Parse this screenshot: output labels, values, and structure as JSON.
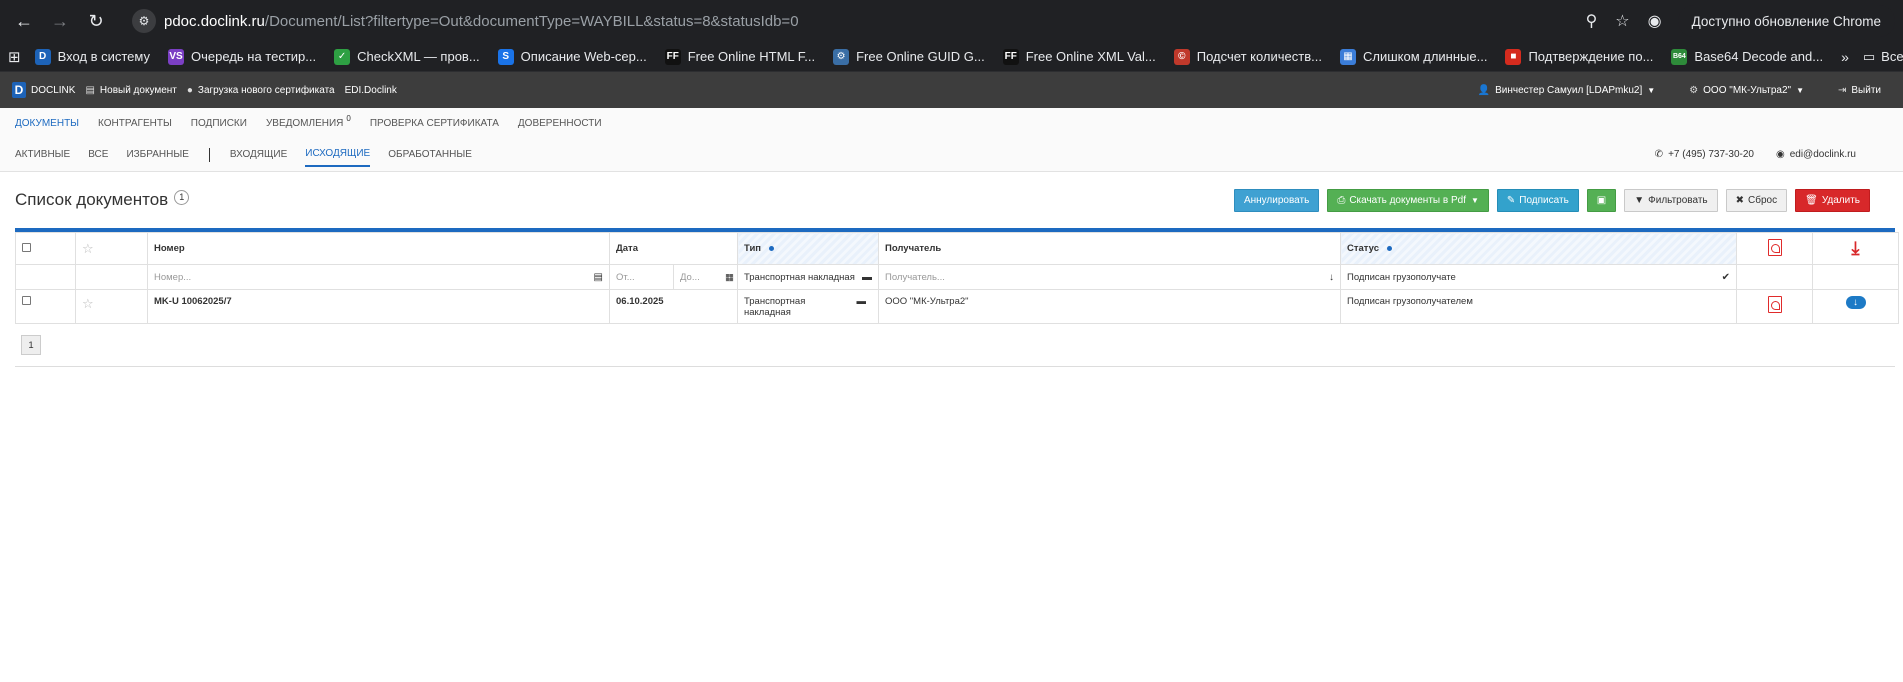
{
  "browser": {
    "url_host": "pdoc.doclink.ru",
    "url_path": "/Document/List?filtertype=Out&documentType=WAYBILL&status=8&statusIdb=0",
    "update_label": "Доступно обновление Chrome"
  },
  "bookmarks": [
    {
      "label": "Вход в систему",
      "icon": "D",
      "color": "#1d63b8"
    },
    {
      "label": "Очередь на тестир...",
      "icon": "VS",
      "color": "#7b3fc4"
    },
    {
      "label": "CheckXML — пров...",
      "icon": "✓",
      "color": "#2ea043"
    },
    {
      "label": "Описание Web-сер...",
      "icon": "S",
      "color": "#1a73e8"
    },
    {
      "label": "Free Online HTML F...",
      "icon": "FF",
      "color": "#111111"
    },
    {
      "label": "Free Online GUID G...",
      "icon": "⚙",
      "color": "#3a6ea5"
    },
    {
      "label": "Free Online XML Val...",
      "icon": "FF",
      "color": "#111111"
    },
    {
      "label": "Подсчет количеств...",
      "icon": "©",
      "color": "#c0392b"
    },
    {
      "label": "Слишком длинные...",
      "icon": "▦",
      "color": "#3b7dd8"
    },
    {
      "label": "Подтверждение по...",
      "icon": "■",
      "color": "#d52b1e"
    },
    {
      "label": "Base64 Decode and...",
      "icon": "B64",
      "color": "#2e8b3a"
    }
  ],
  "bookmarks_folder": "Все закладки",
  "app": {
    "logo": "DOCLINK",
    "new_doc": "Новый документ",
    "upload_cert": "Загрузка нового сертификата",
    "edi": "EDI.Doclink",
    "user": "Винчестер Самуил [LDAPmku2]",
    "org": "ООО \"МК-Ультра2\"",
    "logout": "Выйти"
  },
  "nav_main": [
    {
      "label": "Документы",
      "active": true
    },
    {
      "label": "Контрагенты",
      "active": false
    },
    {
      "label": "Подписки",
      "active": false
    },
    {
      "label": "Уведомления",
      "active": false,
      "badge": "0"
    },
    {
      "label": "Проверка сертификата",
      "active": false
    },
    {
      "label": "Доверенности",
      "active": false
    }
  ],
  "nav_sub": [
    {
      "label": "Активные",
      "active": false
    },
    {
      "label": "Все",
      "active": false
    },
    {
      "label": "Избранные",
      "active": false
    },
    {
      "label": "Входящие",
      "active": false
    },
    {
      "label": "Исходящие",
      "active": true
    },
    {
      "label": "Обработанные",
      "active": false
    }
  ],
  "contact": {
    "phone": "+7 (495) 737-30-20",
    "email": "edi@doclink.ru"
  },
  "page": {
    "title": "Список документов",
    "count": "1"
  },
  "actions": {
    "annul": "Аннулировать",
    "download_pdf": "Скачать документы в Pdf",
    "sign": "Подписать",
    "filter": "Фильтровать",
    "reset": "Сброс",
    "delete": "Удалить"
  },
  "table": {
    "headers": {
      "number": "Номер",
      "date": "Дата",
      "type": "Тип",
      "recipient": "Получатель",
      "status": "Статус"
    },
    "filters": {
      "number_ph": "Номер...",
      "date_from_ph": "От...",
      "date_to_ph": "До...",
      "type_value": "Транспортная накладная",
      "recipient_ph": "Получатель...",
      "status_value": "Подписан грузополучате"
    },
    "rows": [
      {
        "number": "MK-U 10062025/7",
        "date": "06.10.2025",
        "type": "Транспортная накладная",
        "recipient": "ООО \"МК-Ультра2\"",
        "status": "Подписан грузополучателем"
      }
    ]
  },
  "pagination": {
    "current": "1"
  }
}
